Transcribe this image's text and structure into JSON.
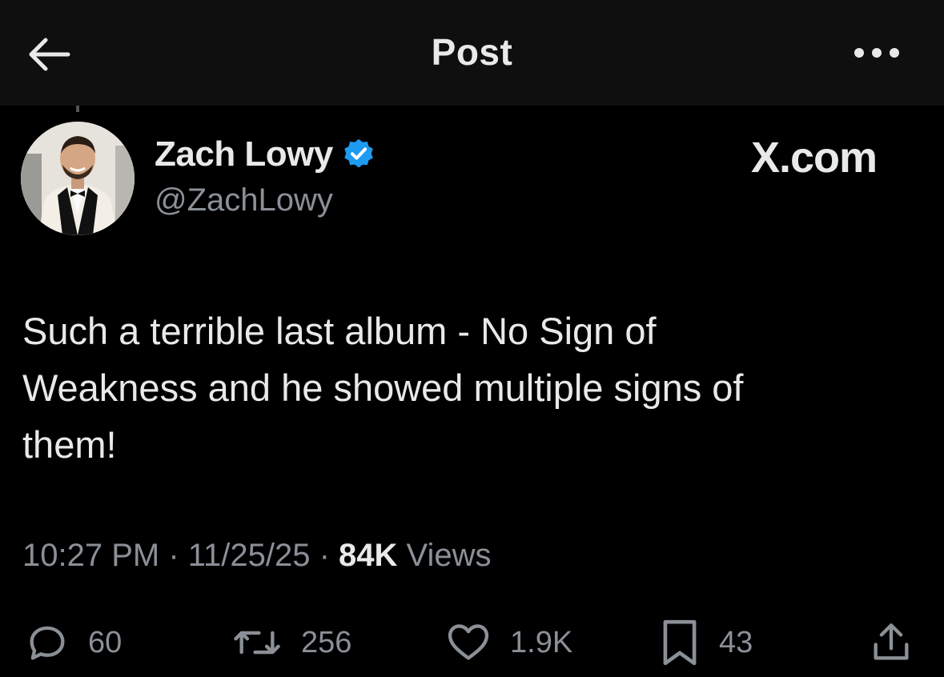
{
  "header": {
    "title": "Post"
  },
  "author": {
    "name": "Zach Lowy",
    "handle": "@ZachLowy",
    "verified": true
  },
  "source_label": "X.com",
  "tweet": {
    "lines": [
      "Such a terrible last album - No Sign of",
      "Weakness and he showed multiple signs of",
      "them!"
    ]
  },
  "meta": {
    "time": "10:27 PM",
    "sep1": " · ",
    "date": "11/25/25",
    "sep2": " · ",
    "views_count": "84K",
    "views_label": " Views"
  },
  "actions": {
    "replies": "60",
    "reposts": "256",
    "likes": "1.9K",
    "bookmarks": "43"
  },
  "icons": [
    "back-arrow-icon",
    "more-icon",
    "verified-badge-icon",
    "reply-icon",
    "repost-icon",
    "like-icon",
    "bookmark-icon",
    "share-icon"
  ],
  "colors": {
    "background": "#000000",
    "text": "#e7e9ea",
    "muted": "#8b9096",
    "verified": "#1d9bf0"
  }
}
